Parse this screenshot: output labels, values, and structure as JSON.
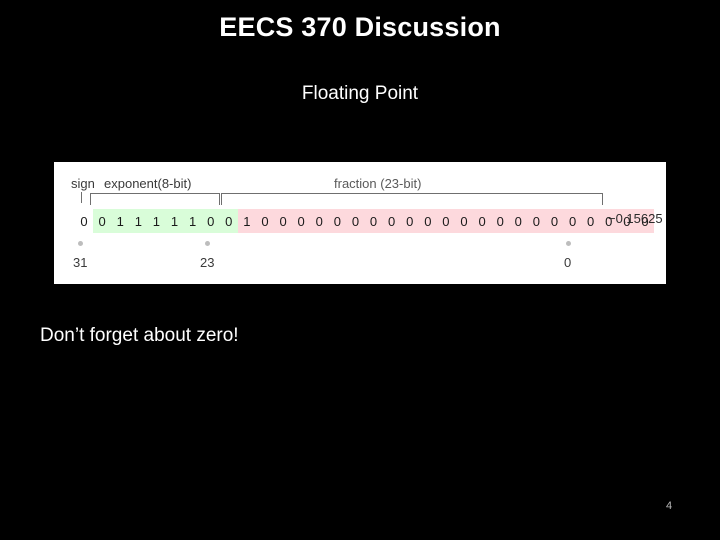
{
  "slide": {
    "title": "EECS 370 Discussion",
    "subtitle": "Floating Point",
    "note": "Don’t forget about zero!",
    "page_number": "4",
    "background_color": "#000000",
    "text_color": "#ffffff"
  },
  "figure": {
    "labels": {
      "sign": "sign",
      "exponent": "exponent(8-bit)",
      "fraction": "fraction (23-bit)"
    },
    "value": "−0.15625",
    "bits": "00111110010000000000000000000000",
    "sign_bits": "0",
    "exponent_bits": "01111100",
    "fraction_bits": "10000000000000000000000",
    "indices": {
      "left": "31",
      "middle": "23",
      "right": "0"
    },
    "colors": {
      "sign": "#ffffff",
      "exponent": "#d9fdd9",
      "fraction": "#fdd9dd",
      "panel": "#ffffff"
    }
  }
}
